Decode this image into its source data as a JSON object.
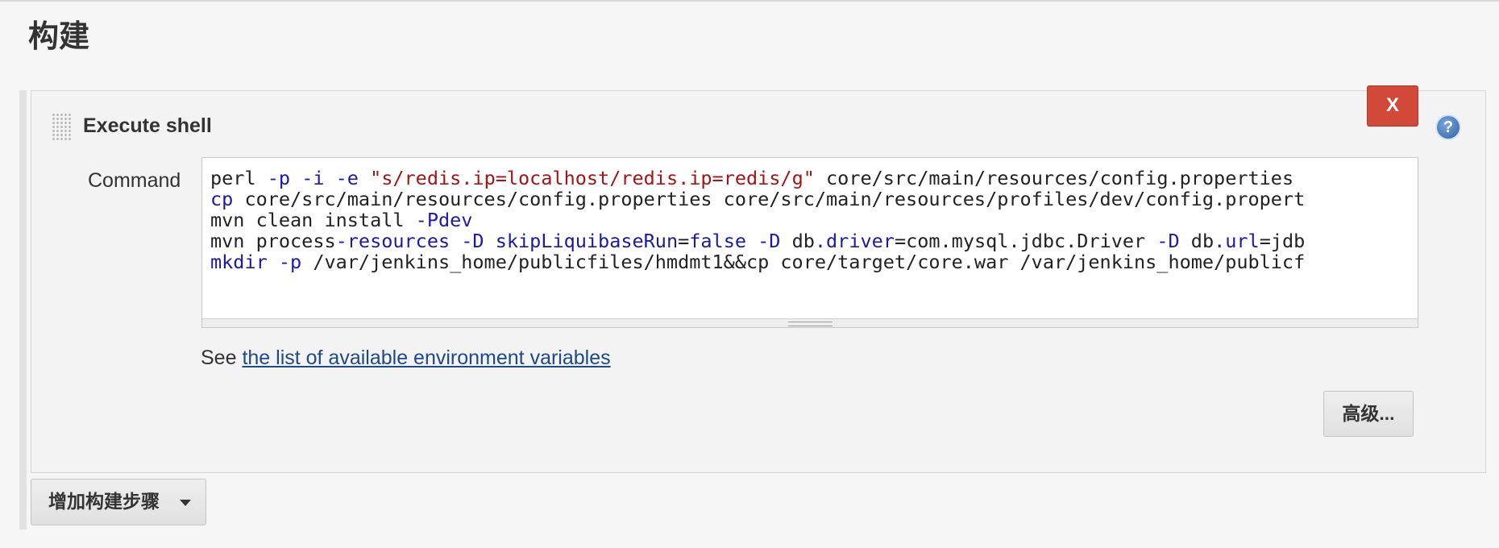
{
  "section": {
    "title": "构建"
  },
  "step": {
    "title": "Execute shell",
    "delete_label": "X",
    "help_label": "?",
    "command_label": "Command",
    "command_lines": [
      [
        {
          "t": "perl ",
          "c": ""
        },
        {
          "t": "-p -i -e ",
          "c": "kw"
        },
        {
          "t": "\"s/redis.ip=localhost/redis.ip=redis/g\"",
          "c": "str"
        },
        {
          "t": " core/src/main/resources/config.properties",
          "c": ""
        }
      ],
      [
        {
          "t": "cp",
          "c": "kw"
        },
        {
          "t": " core/src/main/resources/config.properties core/src/main/resources/profiles/dev/config.propert",
          "c": ""
        }
      ],
      [
        {
          "t": "mvn clean install ",
          "c": ""
        },
        {
          "t": "-Pdev",
          "c": "kw"
        }
      ],
      [
        {
          "t": "mvn process",
          "c": ""
        },
        {
          "t": "-resources -D skipLiquibaseRun",
          "c": "kw"
        },
        {
          "t": "=",
          "c": ""
        },
        {
          "t": "false -D",
          "c": "kw"
        },
        {
          "t": " db",
          "c": ""
        },
        {
          "t": ".driver",
          "c": "kw"
        },
        {
          "t": "=com.mysql.jdbc.Driver ",
          "c": ""
        },
        {
          "t": "-D",
          "c": "kw"
        },
        {
          "t": " db",
          "c": ""
        },
        {
          "t": ".url",
          "c": "kw"
        },
        {
          "t": "=jdb",
          "c": ""
        }
      ],
      [
        {
          "t": "mkdir -p",
          "c": "kw"
        },
        {
          "t": " /var/jenkins_home/publicfiles/hmdmt1&&cp core/target/core.war /var/jenkins_home/publicf",
          "c": ""
        }
      ]
    ],
    "env_prefix": "See ",
    "env_link": "the list of available environment variables",
    "advanced_label": "高级..."
  },
  "add_step": {
    "label": "增加构建步骤"
  }
}
